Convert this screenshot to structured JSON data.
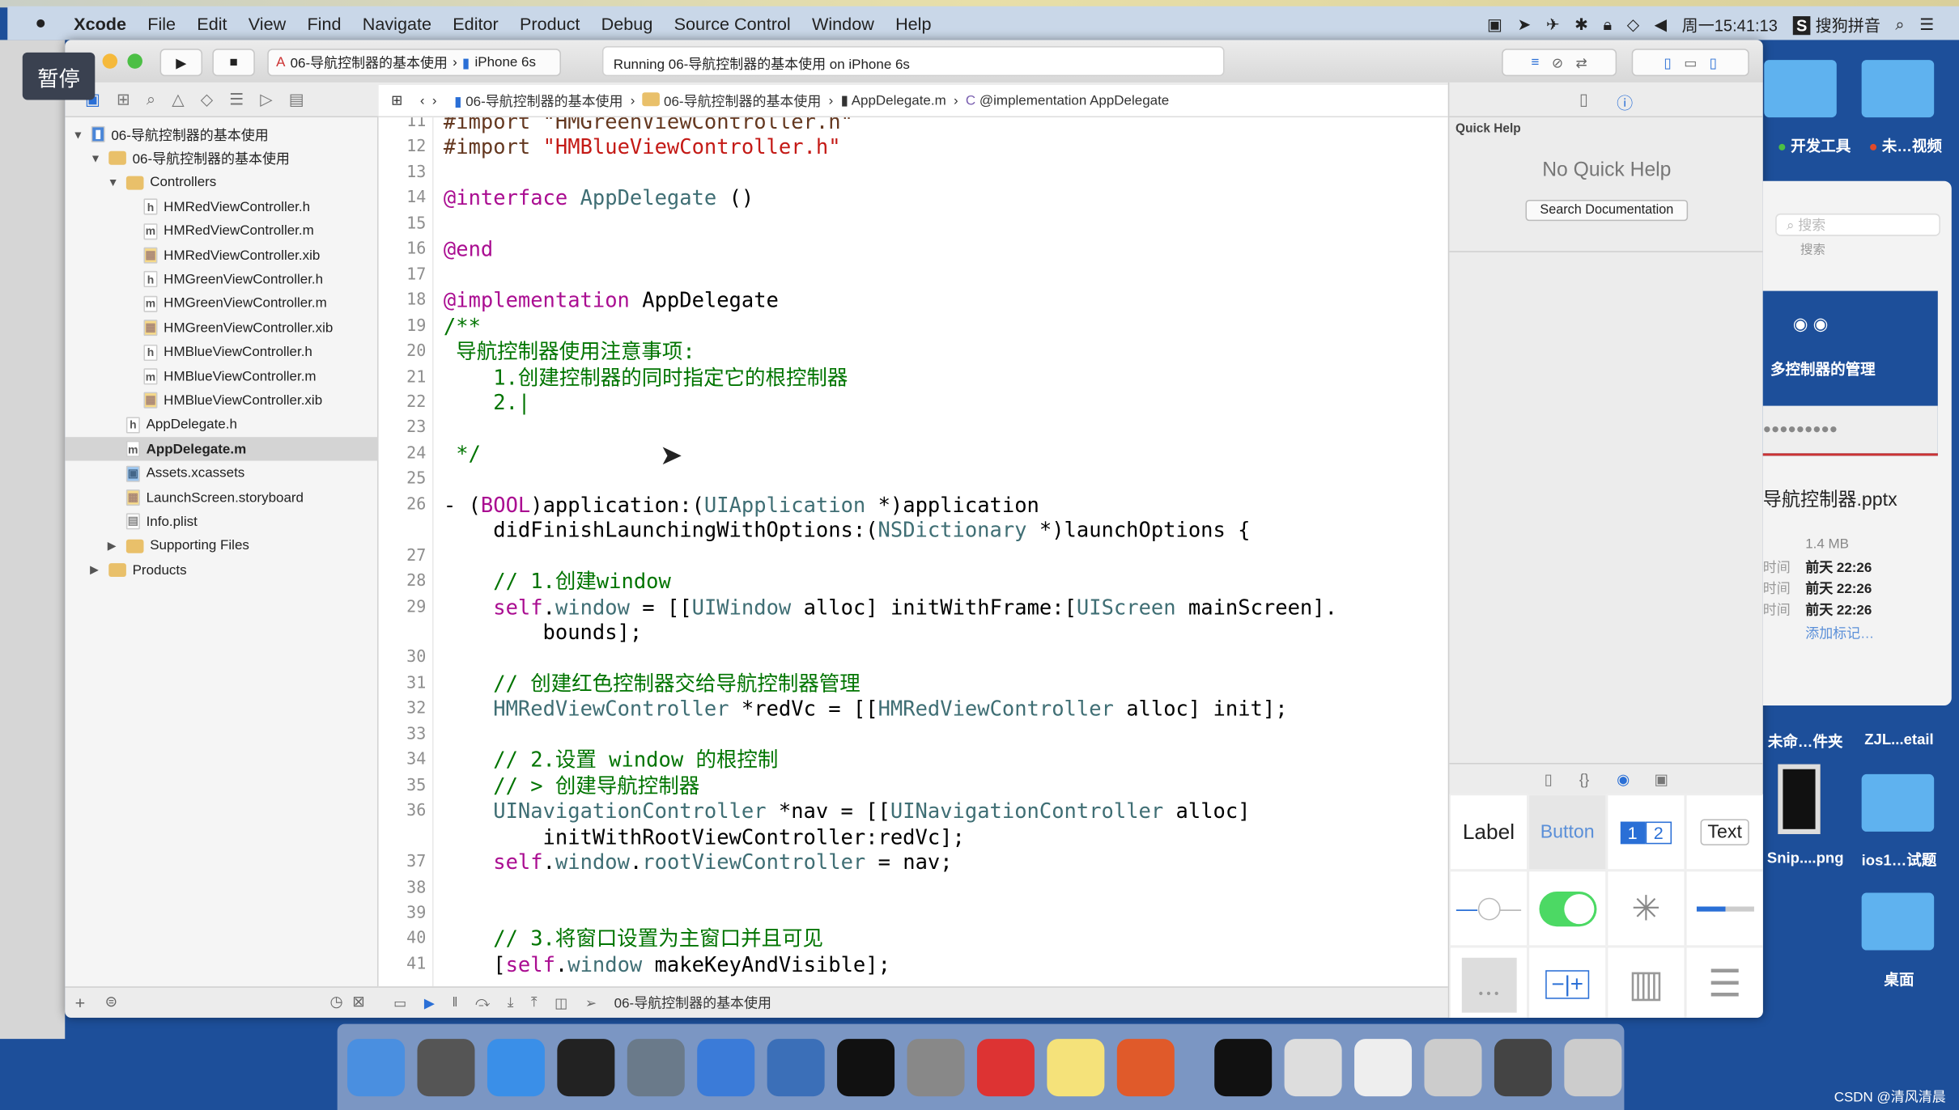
{
  "menubar": {
    "apple": "",
    "app": "Xcode",
    "items": [
      "File",
      "Edit",
      "View",
      "Find",
      "Navigate",
      "Editor",
      "Product",
      "Debug",
      "Source Control",
      "Window",
      "Help"
    ],
    "clock": "周一15:41:13",
    "ime": "搜狗拼音"
  },
  "overlay": {
    "pause": "暂停"
  },
  "toolbar": {
    "scheme": "06-导航控制器的基本使用",
    "device": "iPhone 6s",
    "activity": "Running 06-导航控制器的基本使用 on iPhone 6s"
  },
  "jumpbar": {
    "items": [
      "06-导航控制器的基本使用",
      "06-导航控制器的基本使用",
      "AppDelegate.m",
      "@implementation AppDelegate"
    ]
  },
  "navigator": {
    "items": [
      {
        "label": "06-导航控制器的基本使用",
        "type": "project",
        "depth": 0,
        "open": true
      },
      {
        "label": "06-导航控制器的基本使用",
        "type": "folder",
        "depth": 1,
        "open": true
      },
      {
        "label": "Controllers",
        "type": "folder",
        "depth": 2,
        "open": true
      },
      {
        "label": "HMRedViewController.h",
        "type": "h",
        "depth": 3
      },
      {
        "label": "HMRedViewController.m",
        "type": "m",
        "depth": 3
      },
      {
        "label": "HMRedViewController.xib",
        "type": "xib",
        "depth": 3
      },
      {
        "label": "HMGreenViewController.h",
        "type": "h",
        "depth": 3
      },
      {
        "label": "HMGreenViewController.m",
        "type": "m",
        "depth": 3
      },
      {
        "label": "HMGreenViewController.xib",
        "type": "xib",
        "depth": 3
      },
      {
        "label": "HMBlueViewController.h",
        "type": "h",
        "depth": 3
      },
      {
        "label": "HMBlueViewController.m",
        "type": "m",
        "depth": 3
      },
      {
        "label": "HMBlueViewController.xib",
        "type": "xib",
        "depth": 3
      },
      {
        "label": "AppDelegate.h",
        "type": "h",
        "depth": 2
      },
      {
        "label": "AppDelegate.m",
        "type": "m",
        "depth": 2,
        "selected": true
      },
      {
        "label": "Assets.xcassets",
        "type": "assets",
        "depth": 2
      },
      {
        "label": "LaunchScreen.storyboard",
        "type": "xib",
        "depth": 2
      },
      {
        "label": "Info.plist",
        "type": "plist",
        "depth": 2
      },
      {
        "label": "Supporting Files",
        "type": "folder",
        "depth": 2,
        "open": false
      },
      {
        "label": "Products",
        "type": "folder",
        "depth": 1,
        "open": false
      }
    ]
  },
  "editor": {
    "rows": [
      {
        "n": "11",
        "t": [
          [
            "#import \"HMGreenViewController.h\"",
            "p"
          ]
        ]
      },
      {
        "n": "12",
        "t": [
          [
            "#import ",
            "p"
          ],
          [
            "\"HMBlueViewController.h\"",
            "s"
          ]
        ]
      },
      {
        "n": "13",
        "t": []
      },
      {
        "n": "14",
        "t": [
          [
            "@interface ",
            "k"
          ],
          [
            "AppDelegate",
            "t"
          ],
          [
            " ()",
            "n"
          ]
        ]
      },
      {
        "n": "15",
        "t": []
      },
      {
        "n": "16",
        "t": [
          [
            "@end",
            "k"
          ]
        ]
      },
      {
        "n": "17",
        "t": []
      },
      {
        "n": "18",
        "t": [
          [
            "@implementation ",
            "k"
          ],
          [
            "AppDelegate",
            "n"
          ]
        ]
      },
      {
        "n": "19",
        "t": [
          [
            "/**",
            "c"
          ]
        ]
      },
      {
        "n": "20",
        "t": [
          [
            " 导航控制器使用注意事项:",
            "c"
          ]
        ]
      },
      {
        "n": "21",
        "t": [
          [
            "    1.创建控制器的同时指定它的根控制器",
            "c"
          ]
        ]
      },
      {
        "n": "22",
        "t": [
          [
            "    2.|",
            "c"
          ]
        ]
      },
      {
        "n": "23",
        "t": []
      },
      {
        "n": "24",
        "t": [
          [
            " */",
            "c"
          ]
        ]
      },
      {
        "n": "25",
        "t": []
      },
      {
        "n": "26",
        "t": [
          [
            "- (",
            "n"
          ],
          [
            "BOOL",
            "k"
          ],
          [
            ")application:(",
            "n"
          ],
          [
            "UIApplication",
            "t"
          ],
          [
            " *)application",
            "n"
          ]
        ]
      },
      {
        "n": "",
        "t": [
          [
            "    didFinishLaunchingWithOptions:(",
            "n"
          ],
          [
            "NSDictionary",
            "t"
          ],
          [
            " *)launchOptions {",
            "n"
          ]
        ]
      },
      {
        "n": "27",
        "t": []
      },
      {
        "n": "28",
        "t": [
          [
            "    // 1.创建window",
            "c"
          ]
        ]
      },
      {
        "n": "29",
        "t": [
          [
            "    ",
            "n"
          ],
          [
            "self",
            "k"
          ],
          [
            ".",
            "n"
          ],
          [
            "window",
            "t"
          ],
          [
            " = [[",
            "n"
          ],
          [
            "UIWindow",
            "t"
          ],
          [
            " alloc] initWithFrame:[",
            "n"
          ],
          [
            "UIScreen",
            "t"
          ],
          [
            " mainScreen].",
            "n"
          ]
        ]
      },
      {
        "n": "",
        "t": [
          [
            "        bounds];",
            "n"
          ]
        ]
      },
      {
        "n": "30",
        "t": []
      },
      {
        "n": "31",
        "t": [
          [
            "    // 创建红色控制器交给导航控制器管理",
            "c"
          ]
        ]
      },
      {
        "n": "32",
        "t": [
          [
            "    ",
            "n"
          ],
          [
            "HMRedViewController",
            "t"
          ],
          [
            " *redVc = [[",
            "n"
          ],
          [
            "HMRedViewController",
            "t"
          ],
          [
            " alloc] init];",
            "n"
          ]
        ]
      },
      {
        "n": "33",
        "t": []
      },
      {
        "n": "34",
        "t": [
          [
            "    // 2.设置 window 的根控制",
            "c"
          ]
        ]
      },
      {
        "n": "35",
        "t": [
          [
            "    // > 创建导航控制器",
            "c"
          ]
        ]
      },
      {
        "n": "36",
        "t": [
          [
            "    ",
            "n"
          ],
          [
            "UINavigationController",
            "t"
          ],
          [
            " *nav = [[",
            "n"
          ],
          [
            "UINavigationController",
            "t"
          ],
          [
            " alloc]",
            "n"
          ]
        ]
      },
      {
        "n": "",
        "t": [
          [
            "        initWithRootViewController:redVc];",
            "n"
          ]
        ]
      },
      {
        "n": "37",
        "t": [
          [
            "    ",
            "n"
          ],
          [
            "self",
            "k"
          ],
          [
            ".",
            "n"
          ],
          [
            "window",
            "t"
          ],
          [
            ".",
            "n"
          ],
          [
            "rootViewController",
            "t"
          ],
          [
            " = nav;",
            "n"
          ]
        ]
      },
      {
        "n": "38",
        "t": []
      },
      {
        "n": "39",
        "t": []
      },
      {
        "n": "40",
        "t": [
          [
            "    // 3.将窗口设置为主窗口并且可见",
            "c"
          ]
        ]
      },
      {
        "n": "41",
        "t": [
          [
            "    [",
            "n"
          ],
          [
            "self",
            "k"
          ],
          [
            ".",
            "n"
          ],
          [
            "window",
            "t"
          ],
          [
            " makeKeyAndVisible];",
            "n"
          ]
        ]
      }
    ]
  },
  "debugbar": {
    "target": "06-导航控制器的基本使用"
  },
  "utility": {
    "title": "Quick Help",
    "empty": "No Quick Help",
    "search_button": "Search Documentation",
    "library": {
      "label": "Label",
      "button": "Button",
      "seg1": "1",
      "seg2": "2",
      "text": "Text"
    }
  },
  "finder": {
    "folders": [
      "开发工具",
      "未…视频"
    ],
    "search_placeholder": "搜索",
    "search_label": "搜索",
    "preview_title": "多控制器的管理",
    "filename": "导航控制器.pptx",
    "size": "1.4 MB",
    "meta_labels": [
      "时间",
      "时间",
      "时间"
    ],
    "dates": [
      "前天 22:26",
      "前天 22:26",
      "前天 22:26"
    ],
    "add_tag": "添加标记…"
  },
  "desktop": {
    "items": [
      "未命…件夹",
      "ZJL...etail",
      "Snip....png",
      "ios1…试题",
      "桌面"
    ]
  },
  "dock": {
    "apps": [
      "Finder",
      "Launchpad",
      "Safari",
      "Mouse",
      "Photo Booth",
      "Xcode",
      "Instruments",
      "Terminal",
      "System Preferences",
      "XMind",
      "Notes",
      "Keynote",
      "Console",
      "Preview",
      "TextEdit",
      "Screenshot",
      "Display",
      "Trash"
    ]
  },
  "watermark": "CSDN @清风清晨",
  "colors": {
    "keyword": "#aa0d91",
    "type": "#3f6e74",
    "comment": "#007400",
    "string": "#c41a16",
    "preprocessor": "#643820"
  }
}
